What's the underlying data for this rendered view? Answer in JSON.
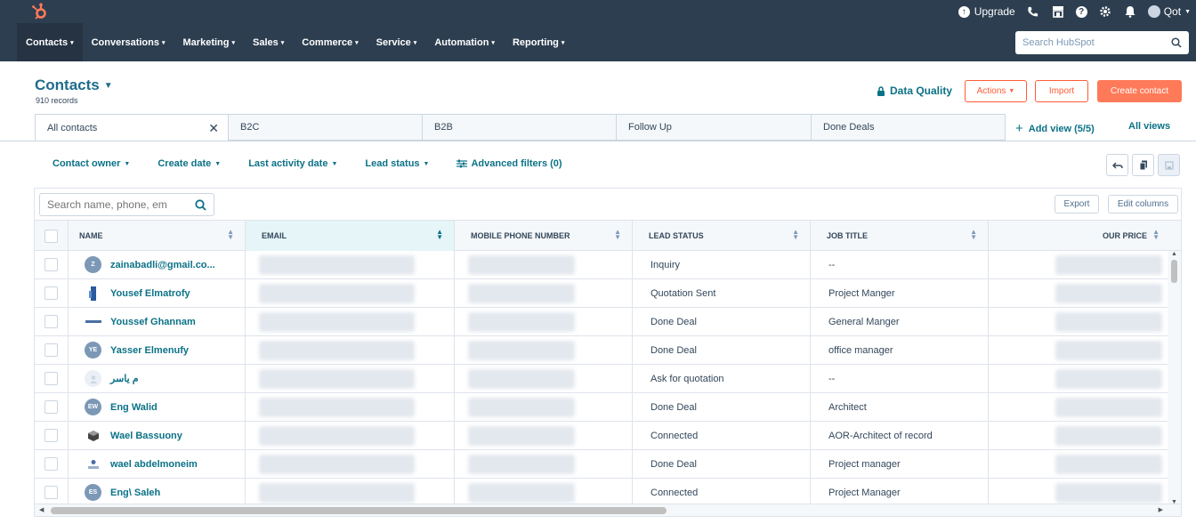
{
  "topbar": {
    "upgrade_label": "Upgrade",
    "account_label": "Qot",
    "icons": [
      "upgrade-icon",
      "calling-icon",
      "marketplace-icon",
      "help-icon",
      "settings-icon",
      "notifications-icon"
    ]
  },
  "nav": {
    "items": [
      {
        "label": "Contacts"
      },
      {
        "label": "Conversations"
      },
      {
        "label": "Marketing"
      },
      {
        "label": "Sales"
      },
      {
        "label": "Commerce"
      },
      {
        "label": "Service"
      },
      {
        "label": "Automation"
      },
      {
        "label": "Reporting"
      }
    ],
    "search_placeholder": "Search HubSpot"
  },
  "header": {
    "title": "Contacts",
    "records": "910 records",
    "data_quality": "Data Quality",
    "actions": "Actions",
    "import": "Import",
    "create": "Create contact"
  },
  "views": {
    "tabs": [
      {
        "label": "All contacts"
      },
      {
        "label": "B2C"
      },
      {
        "label": "B2B"
      },
      {
        "label": "Follow Up"
      },
      {
        "label": "Done Deals"
      }
    ],
    "add_view": "Add view (5/5)",
    "all_views": "All views"
  },
  "filters": {
    "contact_owner": "Contact owner",
    "create_date": "Create date",
    "last_activity": "Last activity date",
    "lead_status": "Lead status",
    "advanced": "Advanced filters (0)"
  },
  "table": {
    "search_placeholder": "Search name, phone, em",
    "export": "Export",
    "edit_columns": "Edit columns",
    "columns": {
      "name": "NAME",
      "email": "EMAIL",
      "phone": "MOBILE PHONE NUMBER",
      "lead_status": "LEAD STATUS",
      "job_title": "JOB TITLE",
      "price": "OUR PRICE"
    },
    "rows": [
      {
        "initials": "Z",
        "name": "zainabadli@gmail.co...",
        "lead_status": "Inquiry",
        "job_title": "--"
      },
      {
        "initials": "",
        "name": "Yousef Elmatrofy",
        "lead_status": "Quotation Sent",
        "job_title": "Project Manger"
      },
      {
        "initials": "",
        "name": "Youssef Ghannam",
        "lead_status": "Done Deal",
        "job_title": "General Manger"
      },
      {
        "initials": "YE",
        "name": "Yasser Elmenufy",
        "lead_status": "Done Deal",
        "job_title": "office manager"
      },
      {
        "initials": "",
        "name": "م ياسر",
        "lead_status": "Ask for quotation",
        "job_title": "--"
      },
      {
        "initials": "EW",
        "name": "Eng Walid",
        "lead_status": "Done Deal",
        "job_title": "Architect"
      },
      {
        "initials": "",
        "name": "Wael Bassuony",
        "lead_status": "Connected",
        "job_title": "AOR-Architect of record"
      },
      {
        "initials": "",
        "name": "wael abdelmoneim",
        "lead_status": "Done Deal",
        "job_title": "Project manager"
      },
      {
        "initials": "ES",
        "name": "Eng\\ Saleh",
        "lead_status": "Connected",
        "job_title": "Project Manager"
      }
    ]
  },
  "colors": {
    "nav_bg": "#2d3e50",
    "accent": "#0b7287",
    "brand_orange": "#ff7a59"
  }
}
